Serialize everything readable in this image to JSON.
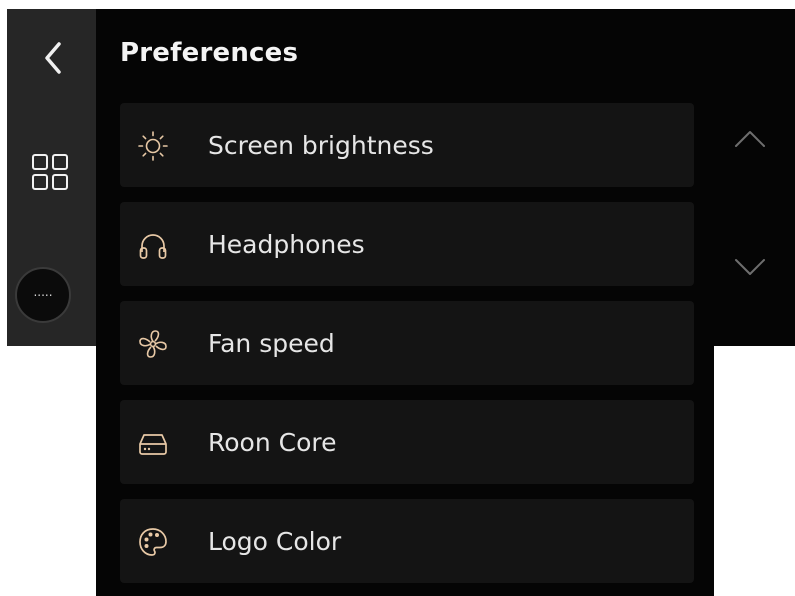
{
  "page": {
    "title": "Preferences"
  },
  "sidebar": {
    "back_icon": "chevron-left-icon",
    "grid_icon": "grid-icon",
    "more_button_text": "....."
  },
  "menu": {
    "items": [
      {
        "label": "Screen brightness",
        "icon": "sun-icon"
      },
      {
        "label": "Headphones",
        "icon": "headphones-icon"
      },
      {
        "label": "Fan speed",
        "icon": "fan-icon"
      },
      {
        "label": "Roon Core",
        "icon": "drive-icon"
      },
      {
        "label": "Logo Color",
        "icon": "palette-icon"
      }
    ]
  },
  "scroll": {
    "up_icon": "chevron-up-icon",
    "down_icon": "chevron-down-icon"
  },
  "colors": {
    "background": "#050505",
    "sidebar": "#262626",
    "card": "#141414",
    "text": "#e6e6e6",
    "icon_accent": "#e8c9a6"
  }
}
